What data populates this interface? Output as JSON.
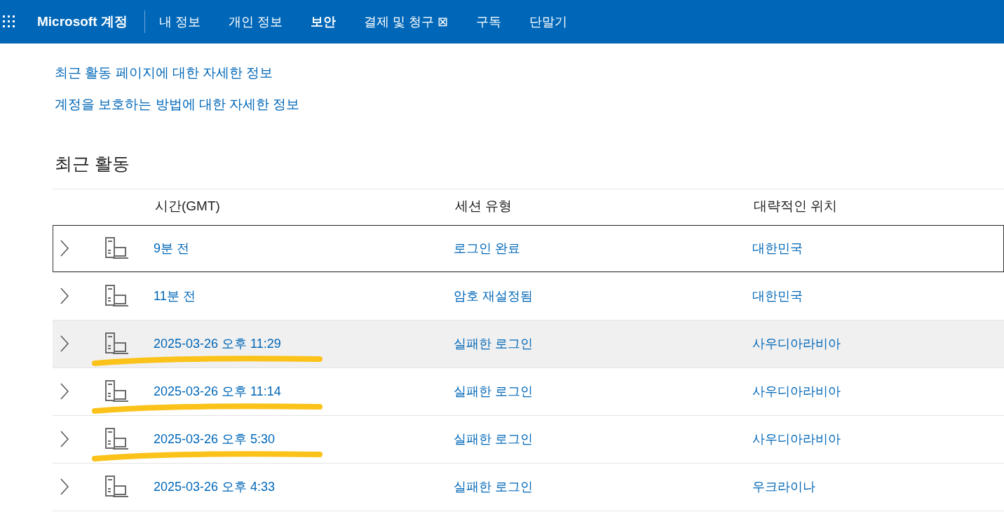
{
  "header": {
    "brand": "Microsoft 계정",
    "nav": [
      {
        "label": "내 정보",
        "selected": false
      },
      {
        "label": "개인 정보",
        "selected": false
      },
      {
        "label": "보안",
        "selected": true
      },
      {
        "label": "결제 및 청구 ⊠",
        "selected": false
      },
      {
        "label": "구독",
        "selected": false
      },
      {
        "label": "단말기",
        "selected": false
      }
    ]
  },
  "links": [
    "최근 활동 페이지에 대한 자세한 정보",
    "계정을 보호하는 방법에 대한 자세한 정보"
  ],
  "section_title": "최근 활동",
  "table": {
    "columns": [
      "시간(GMT)",
      "세션 유형",
      "대략적인 위치"
    ],
    "rows": [
      {
        "time": "9분 전",
        "session": "로그인 완료",
        "location": "대한민국",
        "focused": true,
        "hovered": false,
        "underlined": false
      },
      {
        "time": "11분 전",
        "session": "암호 재설정됨",
        "location": "대한민국",
        "focused": false,
        "hovered": false,
        "underlined": false
      },
      {
        "time": "2025-03-26 오후 11:29",
        "session": "실패한 로그인",
        "location": "사우디아라비아",
        "focused": false,
        "hovered": true,
        "underlined": true
      },
      {
        "time": "2025-03-26 오후 11:14",
        "session": "실패한 로그인",
        "location": "사우디아라비아",
        "focused": false,
        "hovered": false,
        "underlined": true
      },
      {
        "time": "2025-03-26 오후 5:30",
        "session": "실패한 로그인",
        "location": "사우디아라비아",
        "focused": false,
        "hovered": false,
        "underlined": true
      },
      {
        "time": "2025-03-26 오후 4:33",
        "session": "실패한 로그인",
        "location": "우크라이나",
        "focused": false,
        "hovered": false,
        "underlined": false
      }
    ]
  }
}
